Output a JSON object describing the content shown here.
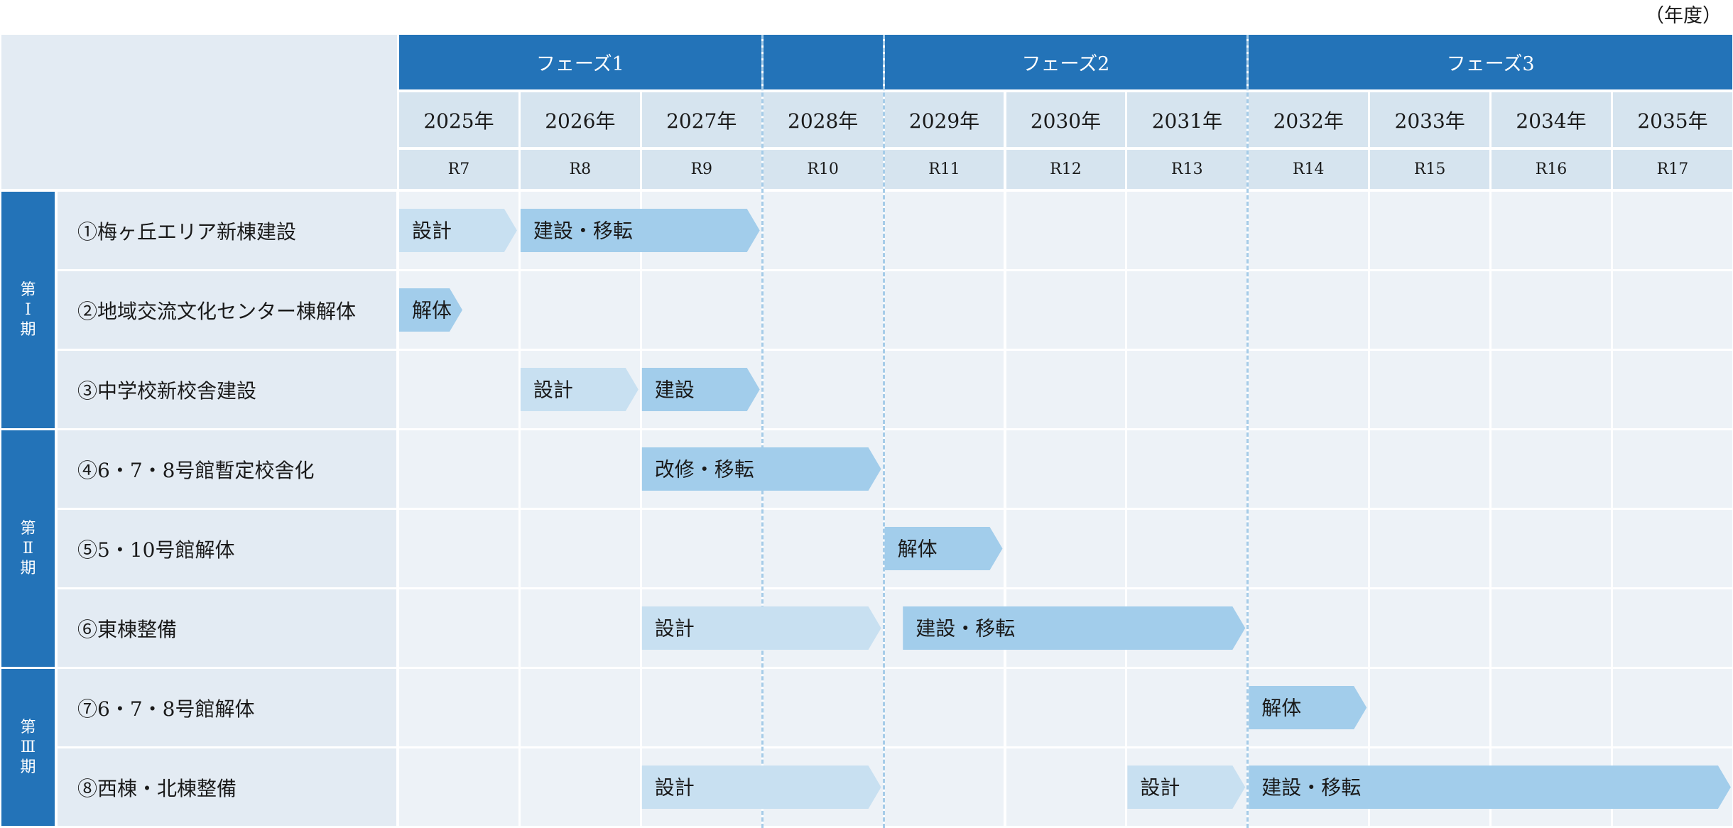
{
  "unit_label": "（年度）",
  "phases": [
    {
      "label": "フェーズ1"
    },
    {
      "label": ""
    },
    {
      "label": "フェーズ2"
    },
    {
      "label": "フェーズ3"
    }
  ],
  "years": [
    "2025年",
    "2026年",
    "2027年",
    "2028年",
    "2029年",
    "2030年",
    "2031年",
    "2032年",
    "2033年",
    "2034年",
    "2035年"
  ],
  "reiwa": [
    "R7",
    "R8",
    "R9",
    "R10",
    "R11",
    "R12",
    "R13",
    "R14",
    "R15",
    "R16",
    "R17"
  ],
  "periods": [
    {
      "chars": [
        "第",
        "Ⅰ",
        "期"
      ]
    },
    {
      "chars": [
        "第",
        "Ⅱ",
        "期"
      ]
    },
    {
      "chars": [
        "第",
        "Ⅲ",
        "期"
      ]
    }
  ],
  "rows": [
    {
      "name": "①梅ヶ丘エリア新棟建設"
    },
    {
      "name": "②地域交流文化センター棟解体"
    },
    {
      "name": "③中学校新校舎建設"
    },
    {
      "name": "④6・7・8号館暫定校舎化"
    },
    {
      "name": "⑤5・10号館解体"
    },
    {
      "name": "⑥東棟整備"
    },
    {
      "name": "⑦6・7・8号館解体"
    },
    {
      "name": "⑧西棟・北棟整備"
    }
  ],
  "bars": [
    {
      "row": 0,
      "start": 2025.0,
      "end": 2026.0,
      "label": "設計",
      "kind": "design"
    },
    {
      "row": 0,
      "start": 2026.0,
      "end": 2028.0,
      "label": "建設・移転",
      "kind": "build"
    },
    {
      "row": 1,
      "start": 2025.0,
      "end": 2025.55,
      "label": "解体",
      "kind": "build"
    },
    {
      "row": 2,
      "start": 2026.0,
      "end": 2027.0,
      "label": "設計",
      "kind": "design"
    },
    {
      "row": 2,
      "start": 2027.0,
      "end": 2028.0,
      "label": "建設",
      "kind": "build"
    },
    {
      "row": 3,
      "start": 2027.0,
      "end": 2029.0,
      "label": "改修・移転",
      "kind": "build"
    },
    {
      "row": 4,
      "start": 2029.0,
      "end": 2030.0,
      "label": "解体",
      "kind": "build"
    },
    {
      "row": 5,
      "start": 2027.0,
      "end": 2029.0,
      "label": "設計",
      "kind": "design"
    },
    {
      "row": 5,
      "start": 2029.15,
      "end": 2032.0,
      "label": "建設・移転",
      "kind": "build"
    },
    {
      "row": 6,
      "start": 2032.0,
      "end": 2033.0,
      "label": "解体",
      "kind": "build"
    },
    {
      "row": 7,
      "start": 2027.0,
      "end": 2029.0,
      "label": "設計",
      "kind": "design"
    },
    {
      "row": 7,
      "start": 2031.0,
      "end": 2032.0,
      "label": "設計",
      "kind": "design"
    },
    {
      "row": 7,
      "start": 2032.0,
      "end": 2036.0,
      "label": "建設・移転",
      "kind": "build"
    }
  ],
  "colors": {
    "header": "#2373b8",
    "design_bar": "#c8e0f1",
    "build_bar": "#a2cdeb",
    "grid_cell": "#edf2f7",
    "label_bg": "#e3ebf3",
    "divider": "#a6cce8"
  }
}
